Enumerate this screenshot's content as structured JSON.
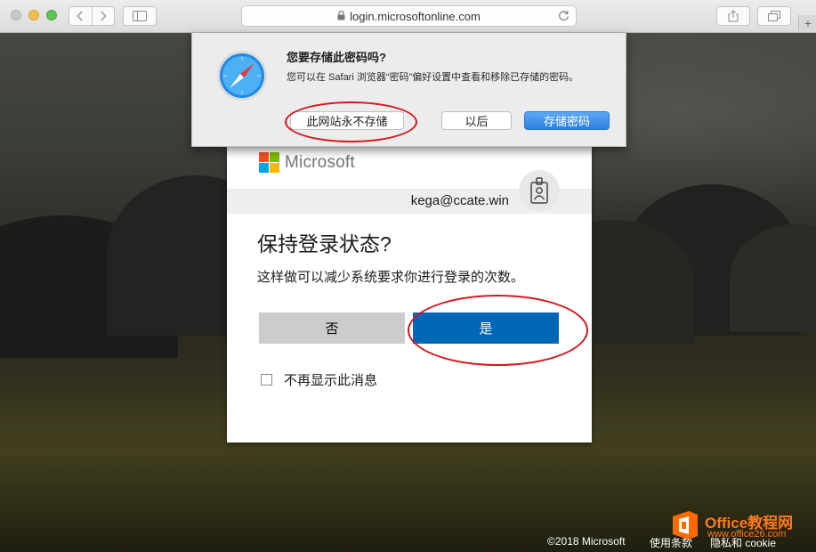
{
  "browser": {
    "url": "login.microsoftonline.com"
  },
  "save_password_sheet": {
    "title": "您要存储此密码吗?",
    "description": "您可以在 Safari 浏览器“密码”偏好设置中查看和移除已存储的密码。",
    "never_label": "此网站永不存储",
    "later_label": "以后",
    "save_label": "存储密码"
  },
  "login_card": {
    "brand": "Microsoft",
    "email": "kega@ccate.win",
    "title": "保持登录状态?",
    "description": "这样做可以减少系统要求你进行登录的次数。",
    "no_label": "否",
    "yes_label": "是",
    "checkbox_label": "不再显示此消息",
    "checkbox_checked": false
  },
  "footer": {
    "copyright": "©2018 Microsoft",
    "terms": "使用条款",
    "privacy": "隐私和 cookie"
  },
  "watermark": {
    "name": "Office教程网",
    "url": "www.office26.com"
  },
  "colors": {
    "ms_blue": "#0067b8",
    "ms_gray_button": "#cccccc",
    "annotation_red": "#d6141c",
    "watermark_orange": "#ff7a1a"
  }
}
